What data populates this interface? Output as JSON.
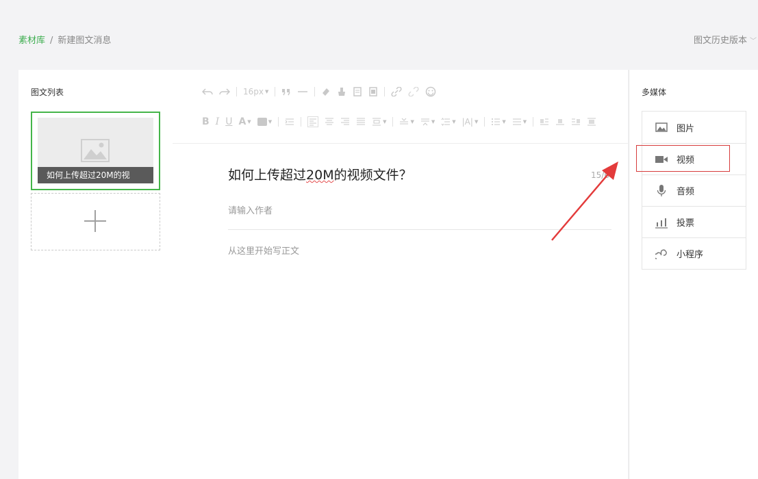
{
  "breadcrumb": {
    "root": "素材库",
    "separator": "/",
    "current": "新建图文消息"
  },
  "history": {
    "label": "图文历史版本"
  },
  "article_list": {
    "title": "图文列表",
    "selected_caption": "如何上传超过20M的视"
  },
  "toolbar": {
    "font_size": "16px"
  },
  "editor": {
    "title_before": "如何上传超过",
    "title_marked": "20M",
    "title_after": "的视频文件？",
    "title_count": "15/64",
    "author_placeholder": "请输入作者",
    "body_placeholder": "从这里开始写正文"
  },
  "media": {
    "title": "多媒体",
    "items": [
      {
        "label": "图片",
        "icon": "image-icon"
      },
      {
        "label": "视频",
        "icon": "video-icon"
      },
      {
        "label": "音频",
        "icon": "microphone-icon"
      },
      {
        "label": "投票",
        "icon": "poll-icon"
      },
      {
        "label": "小程序",
        "icon": "mini-program-icon"
      }
    ]
  },
  "colors": {
    "accent_green": "#44b549",
    "annotation_red": "#d63b3b"
  }
}
